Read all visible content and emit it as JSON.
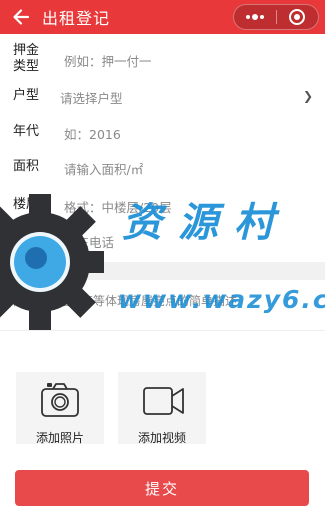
{
  "header": {
    "title": "出租登记",
    "back_icon": "arrow-left-icon",
    "more_icon": "more-dots-icon",
    "close_icon": "record-circle-icon",
    "color": "#e8383a"
  },
  "form": {
    "deposit_label": "押金\n类型",
    "deposit_placeholder": "例如：押一付一",
    "layout_label": "户型",
    "layout_placeholder": "请选择户型",
    "year_label": "年代",
    "year_placeholder": "如：2016",
    "area_label": "面积",
    "area_placeholder": "请输入面积/㎡",
    "floor_label": "楼层",
    "floor_placeholder": "格式：中楼层/20层",
    "phone_label": "手机",
    "phone_placeholder": "房东电话",
    "desc_title": "描述",
    "desc_placeholder": "请输入房屋配套等体现房屋亮点的简单描述"
  },
  "media": {
    "photo_label": "添加照片",
    "video_label": "添加视频",
    "photo_icon": "camera-icon",
    "video_icon": "video-camera-icon"
  },
  "submit_label": "提交",
  "submit_color": "#e8494b",
  "watermark": {
    "chinese": "资源村",
    "url": "www.wazy6.c"
  }
}
